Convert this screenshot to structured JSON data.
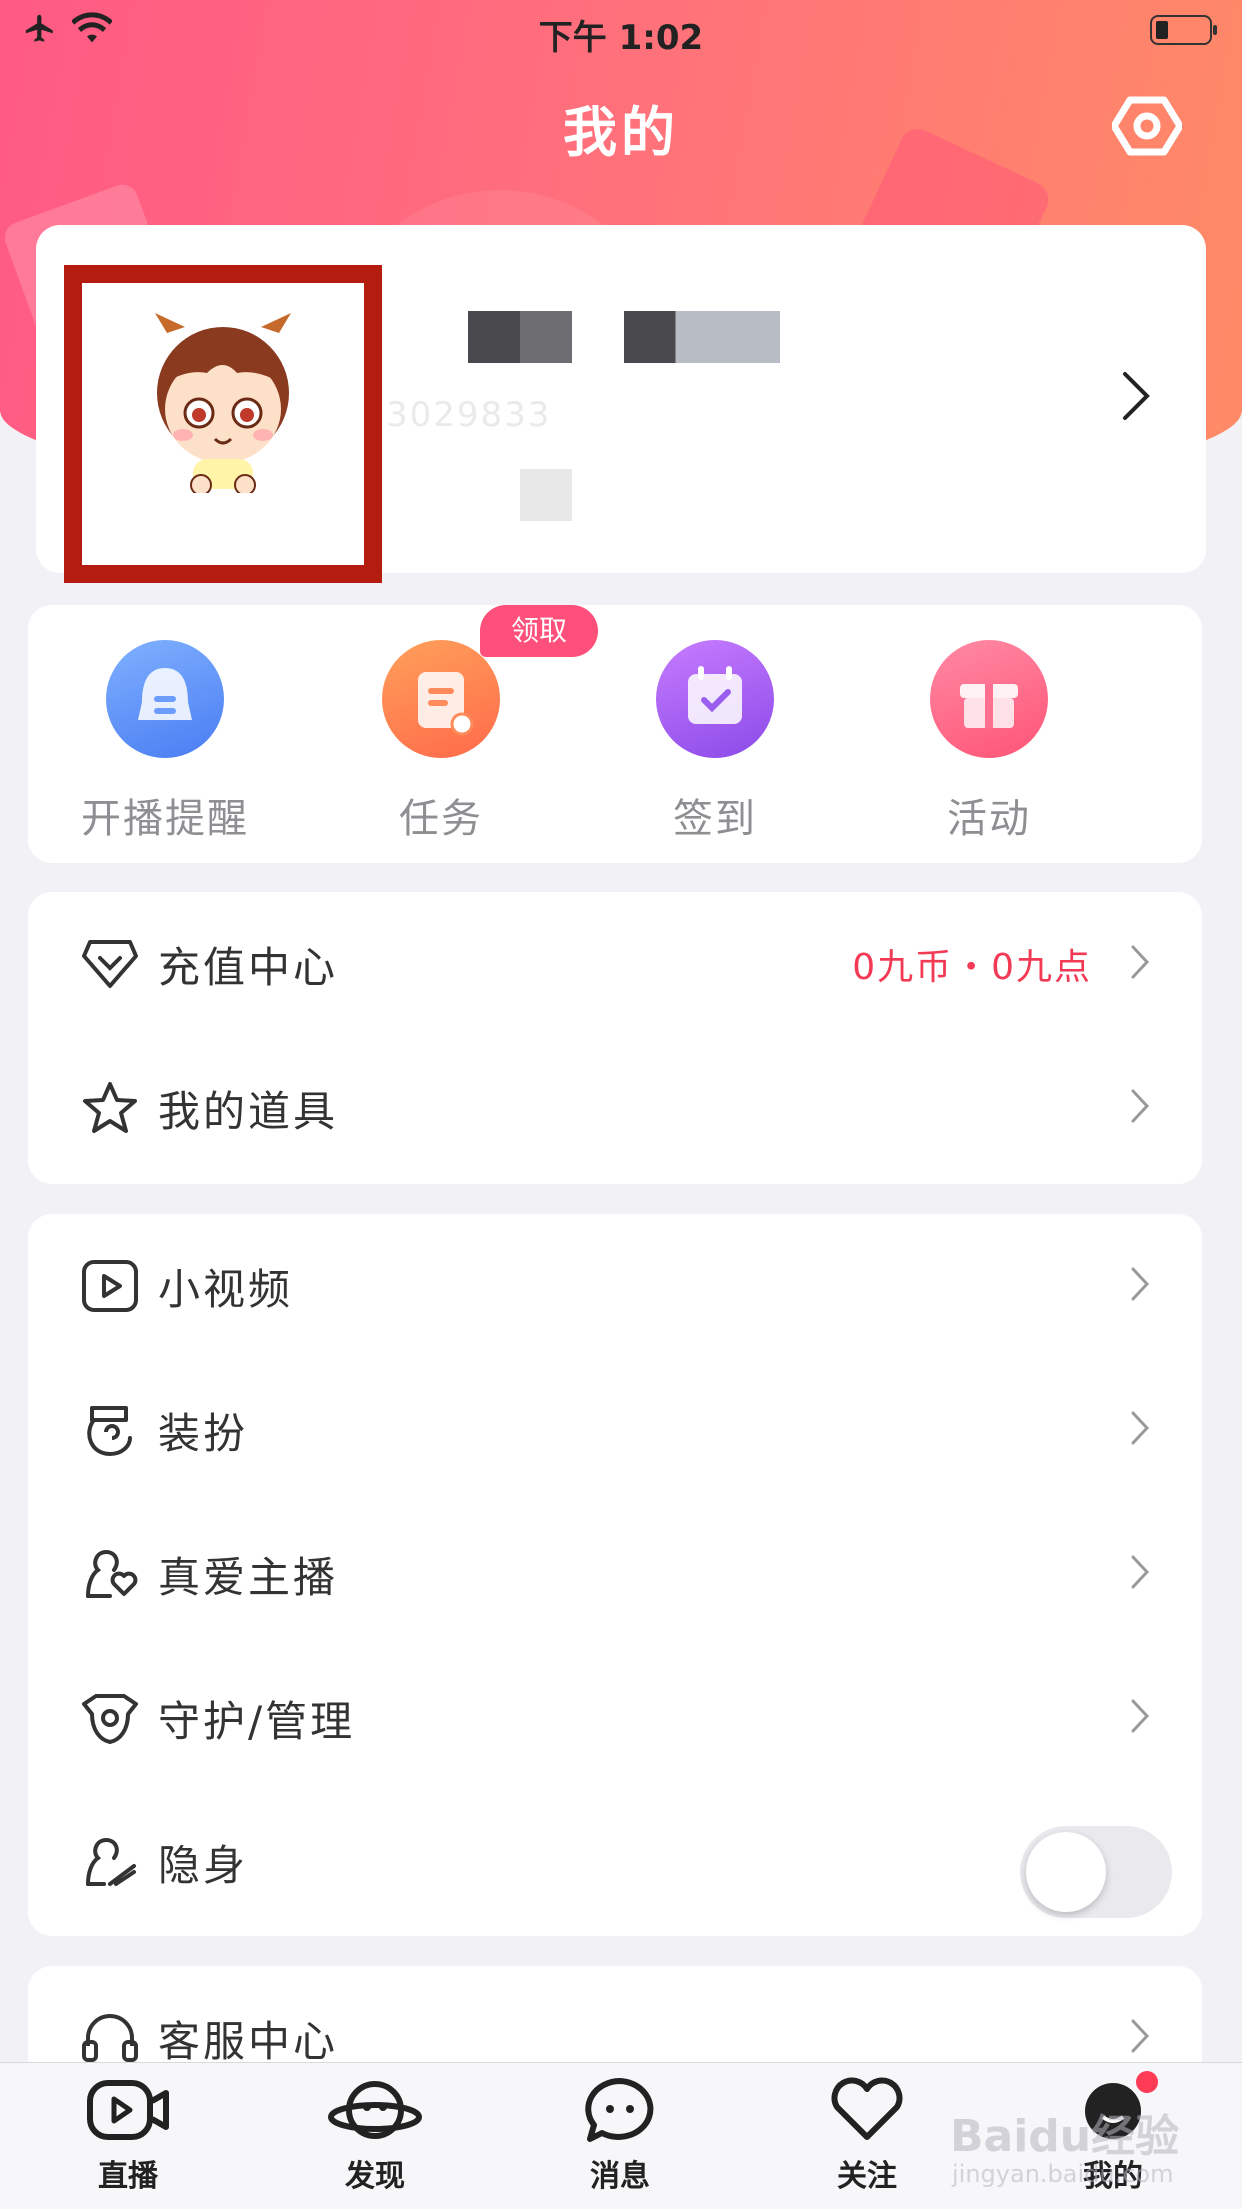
{
  "status_bar": {
    "time": "下午 1:02"
  },
  "header": {
    "title": "我的"
  },
  "profile": {
    "uid": "3029833"
  },
  "quick_actions": [
    {
      "label": "开播提醒",
      "icon": "bell-icon",
      "color": "#5b8dfb"
    },
    {
      "label": "任务",
      "icon": "task-clipboard-icon",
      "color": "#ff7a4e"
    },
    {
      "label": "签到",
      "icon": "calendar-check-icon",
      "color": "#a55df4"
    },
    {
      "label": "活动",
      "icon": "gift-icon",
      "color": "#ff5b7c"
    }
  ],
  "quick_badge": "领取",
  "menu_group1": [
    {
      "label": "充值中心",
      "icon": "diamond-icon",
      "extra": "0九币・0九点"
    },
    {
      "label": "我的道具",
      "icon": "star-icon"
    }
  ],
  "menu_group2": [
    {
      "label": "小视频",
      "icon": "video-play-icon"
    },
    {
      "label": "装扮",
      "icon": "dressup-icon"
    },
    {
      "label": "真爱主播",
      "icon": "heart-anchor-icon"
    },
    {
      "label": "守护/管理",
      "icon": "shield-guard-icon"
    },
    {
      "label": "隐身",
      "icon": "invisible-icon",
      "toggle": false
    }
  ],
  "menu_group3": [
    {
      "label": "客服中心",
      "icon": "headset-icon"
    }
  ],
  "tabbar": [
    {
      "label": "直播",
      "icon": "live-camera-icon"
    },
    {
      "label": "发现",
      "icon": "discover-planet-icon"
    },
    {
      "label": "消息",
      "icon": "message-bubble-icon"
    },
    {
      "label": "关注",
      "icon": "heart-icon"
    },
    {
      "label": "我的",
      "icon": "me-icon"
    }
  ],
  "watermark": {
    "main": "Baidu经验",
    "sub": "jingyan.baidu.com"
  }
}
